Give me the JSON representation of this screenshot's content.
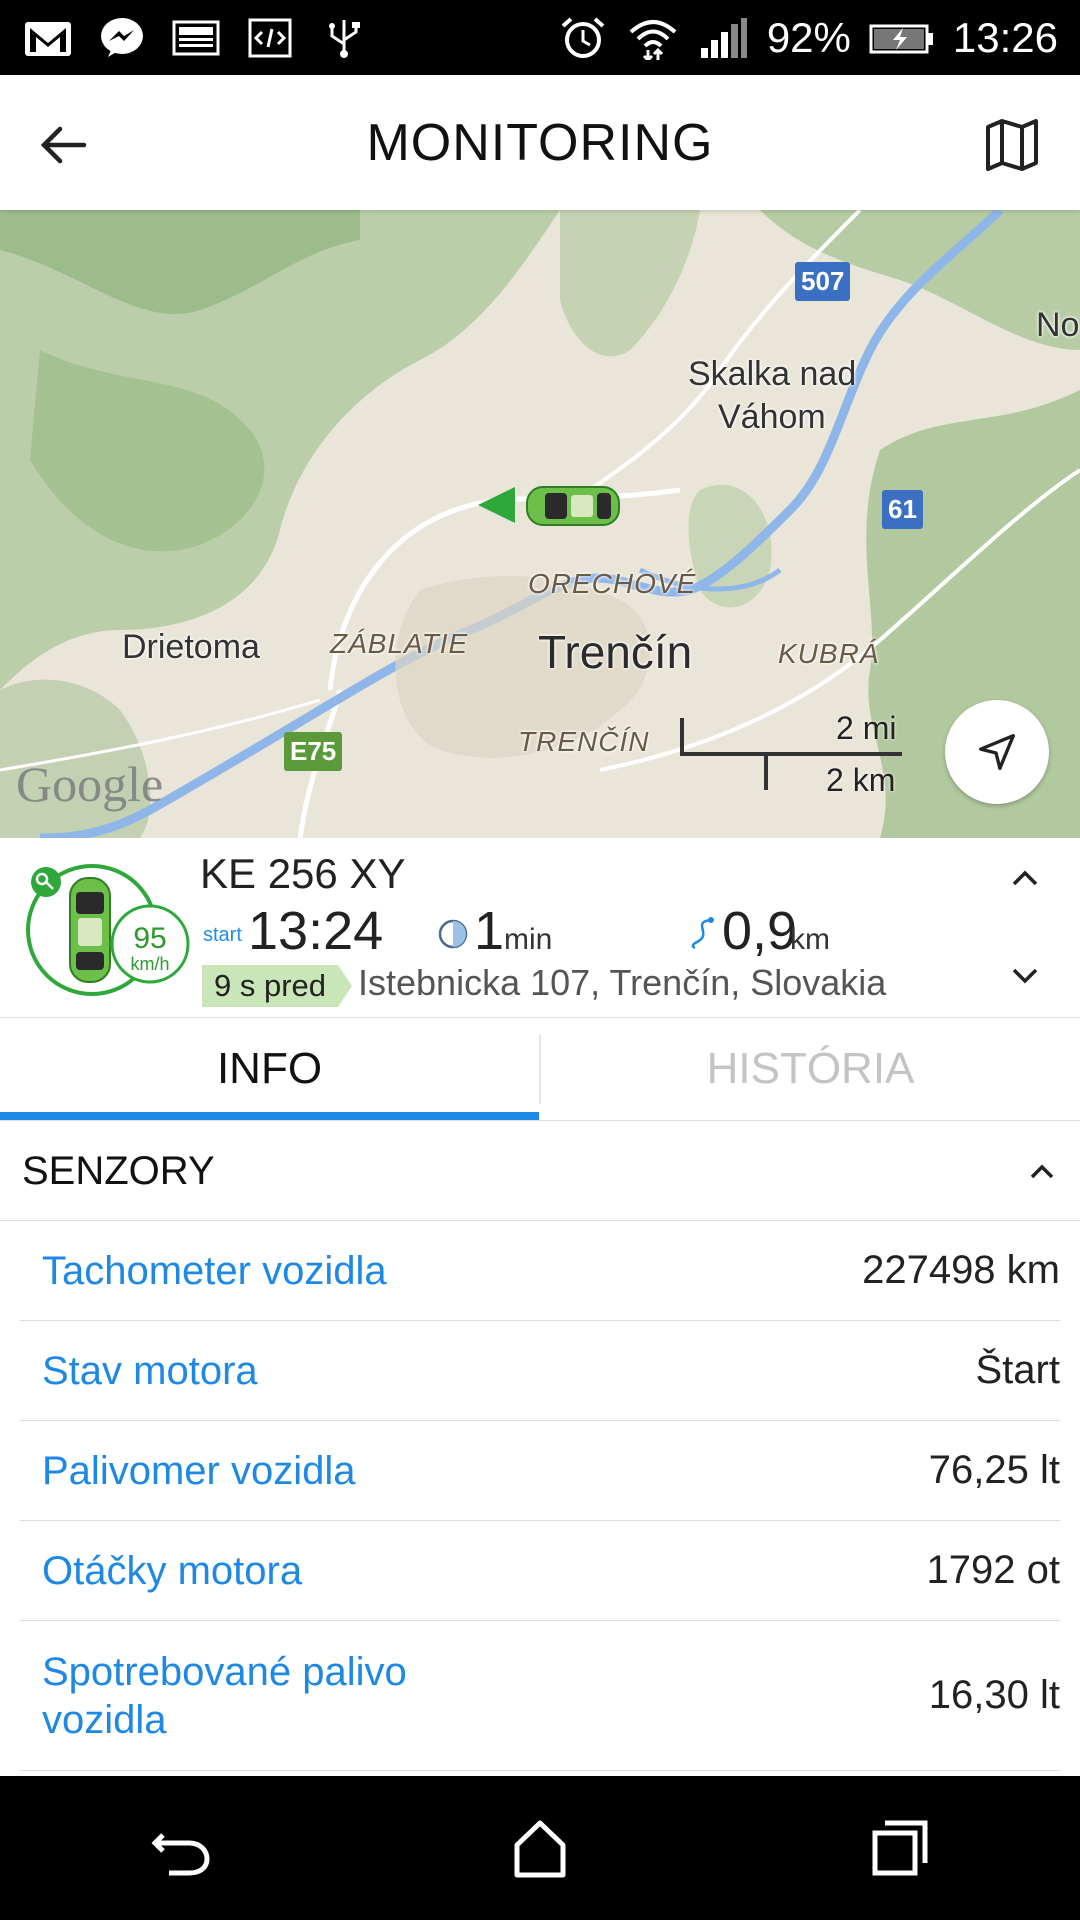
{
  "status_bar": {
    "battery_pct": "92%",
    "time": "13:26",
    "icons": [
      "gmail-icon",
      "messenger-icon",
      "gallery-icon",
      "dev-icon",
      "usb-icon",
      "alarm-icon",
      "wifi-icon",
      "signal-icon",
      "battery-charging-icon"
    ]
  },
  "app_bar": {
    "title": "MONITORING",
    "back_icon": "arrow-back-icon",
    "map_icon": "map-icon"
  },
  "map": {
    "labels": {
      "city": "Trenčín",
      "drietoma": "Drietoma",
      "skalka": "Skalka nad",
      "skalka2": "Váhom",
      "orechove": "ORECHOVÉ",
      "zablatie": "ZÁBLATIE",
      "kubra": "KUBRÁ",
      "trencin_district": "TRENČÍN",
      "no": "No"
    },
    "shields": {
      "r507": "507",
      "r61": "61",
      "e75": "E75"
    },
    "google": "Google",
    "scale": {
      "mi": "2 mi",
      "km": "2 km"
    },
    "locate_icon": "navigation-arrow-icon"
  },
  "vehicle": {
    "plate": "KE 256 XY",
    "speed": "95",
    "speed_unit": "km/h",
    "start_label": "start",
    "start_time": "13:24",
    "duration_value": "1",
    "duration_unit": "min",
    "distance_value": "0,9",
    "distance_unit": "km",
    "ago": "9 s pred",
    "address": "Istebnicka 107, Trenčín, Slovakia"
  },
  "tabs": {
    "info": "INFO",
    "history": "HISTÓRIA"
  },
  "sensors": {
    "title": "SENZORY",
    "rows": [
      {
        "name": "Tachometer vozidla",
        "value": "227498 km"
      },
      {
        "name": "Stav motora",
        "value": "Štart"
      },
      {
        "name": "Palivomer vozidla",
        "value": "76,25 lt"
      },
      {
        "name": "Otáčky motora",
        "value": "1792 ot"
      },
      {
        "name": "Spotrebované palivo vozidla",
        "value": "16,30 lt"
      }
    ]
  },
  "colors": {
    "accent": "#1e88e5",
    "car_green": "#2ea83a",
    "badge_green": "#c9e6b8"
  }
}
